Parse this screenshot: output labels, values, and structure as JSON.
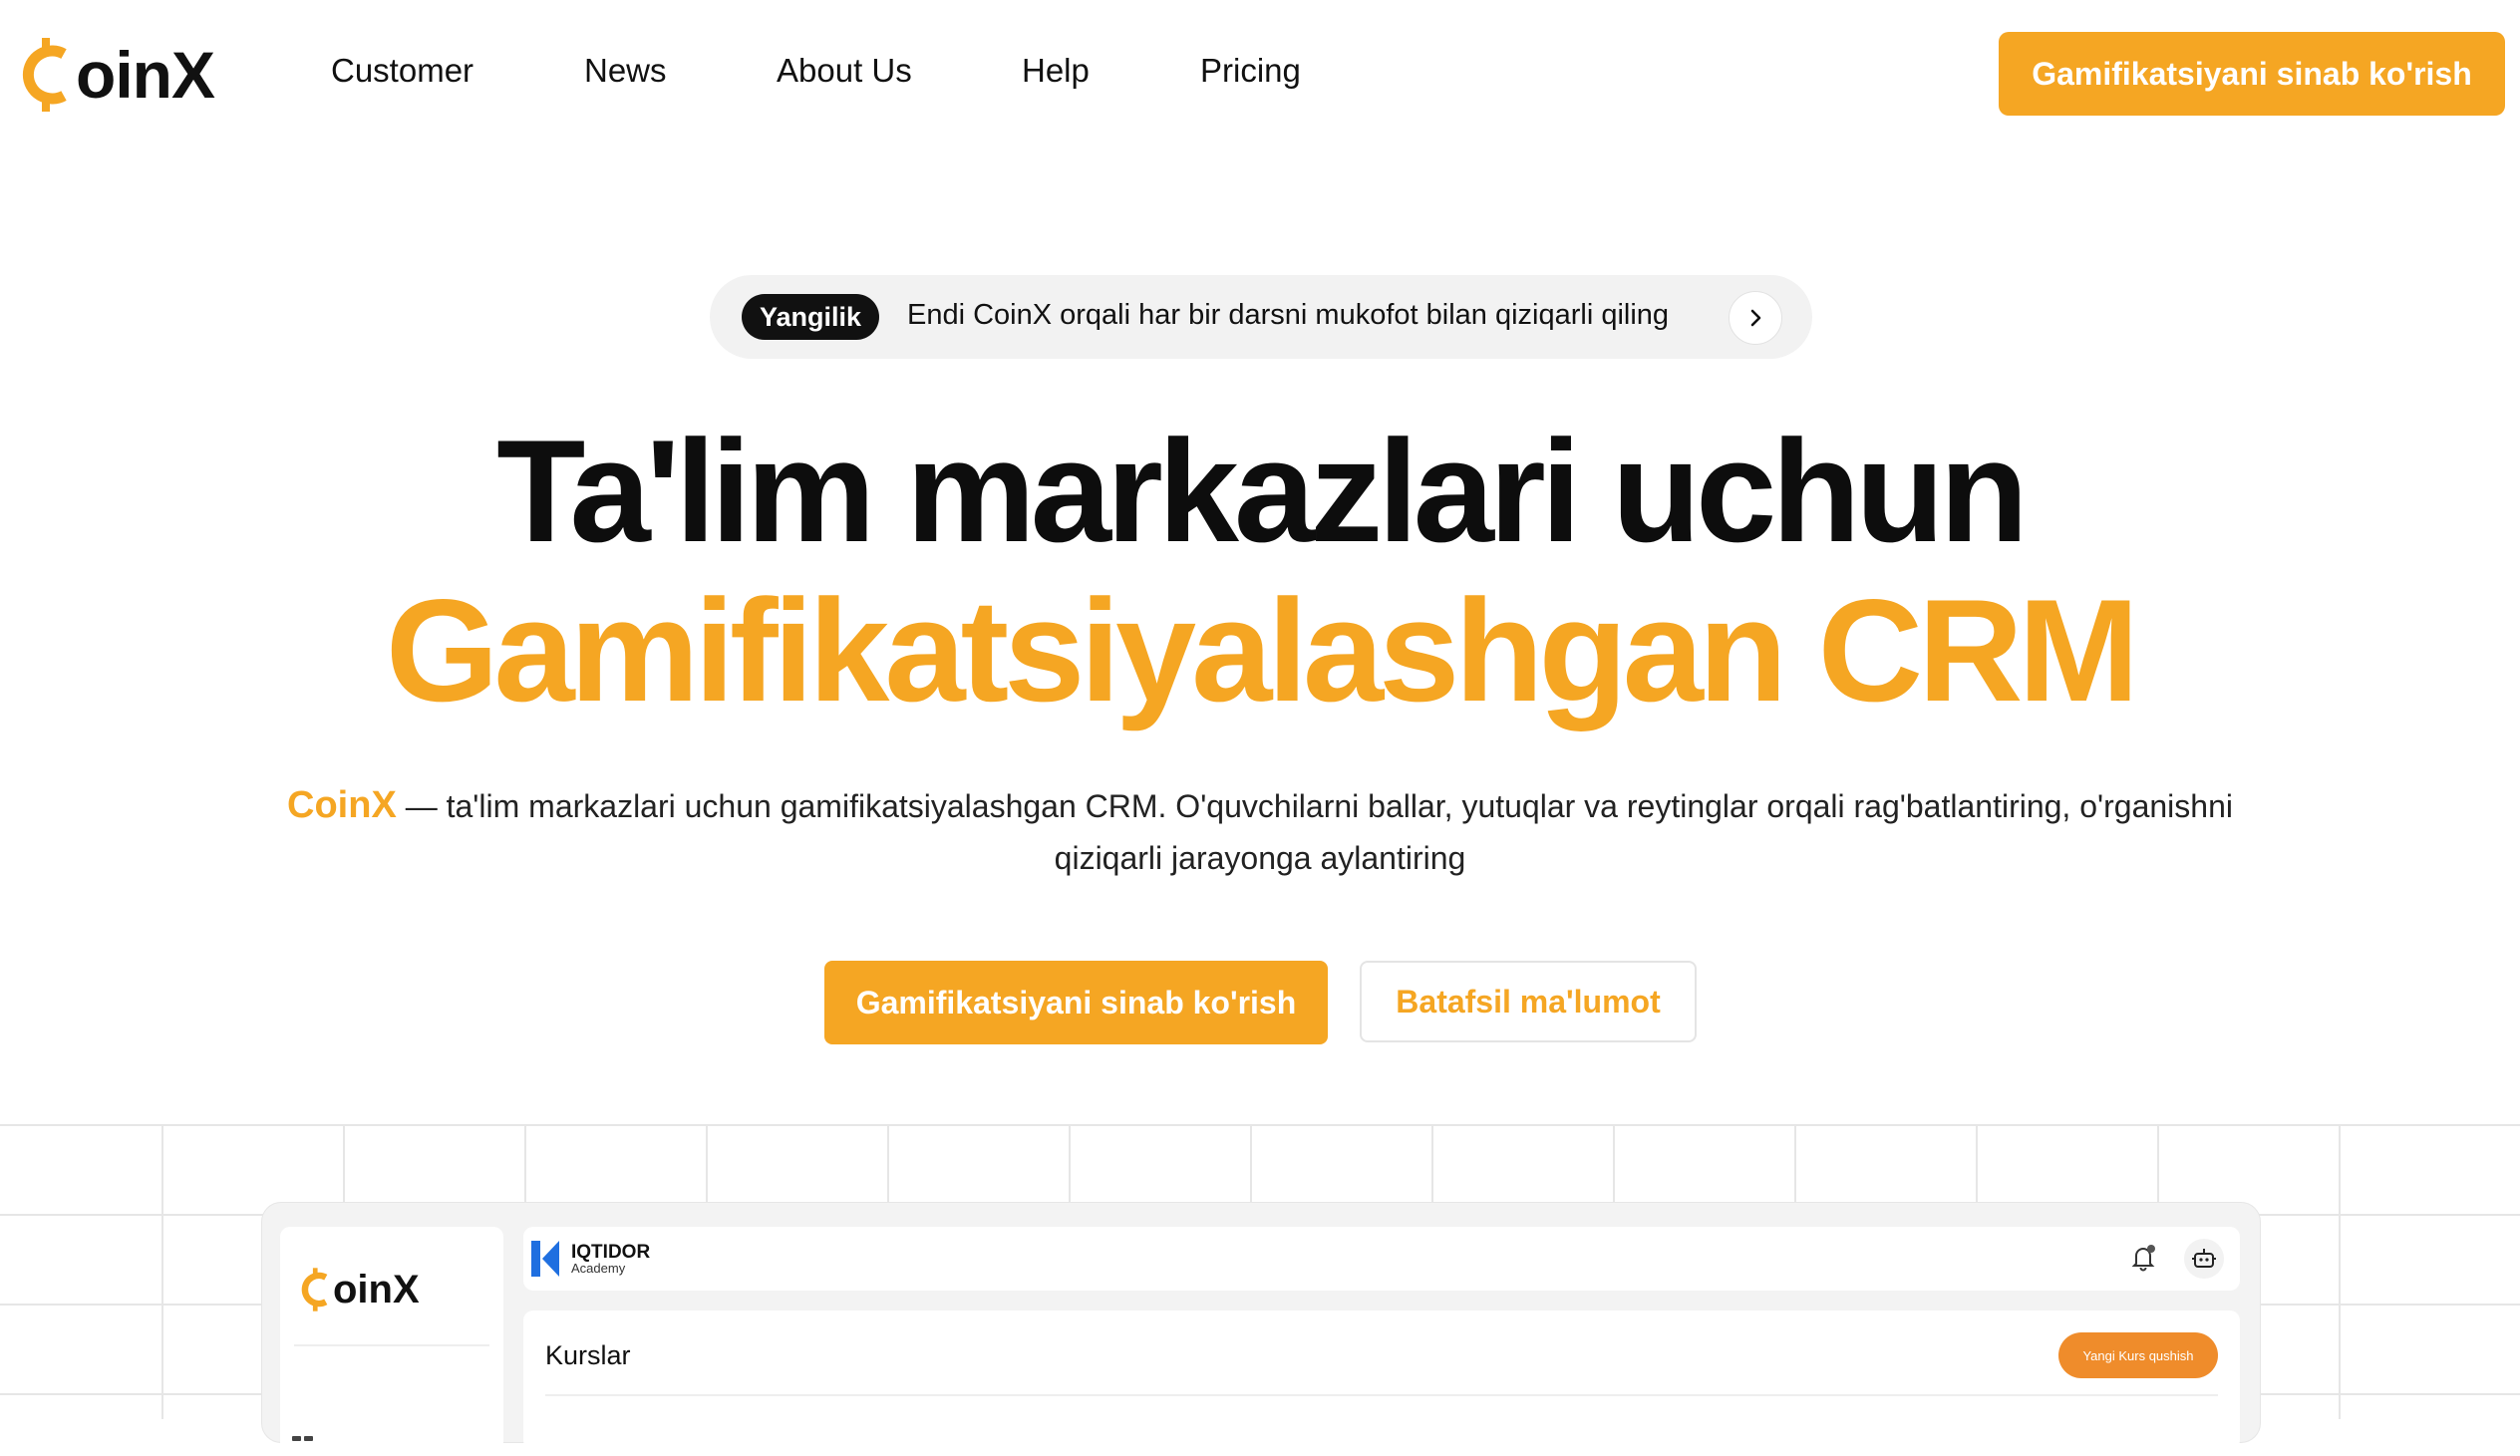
{
  "header": {
    "logo_text": "oinX",
    "nav": [
      {
        "label": "Customer"
      },
      {
        "label": "News"
      },
      {
        "label": "About Us"
      },
      {
        "label": "Help"
      },
      {
        "label": "Pricing"
      }
    ],
    "cta_label": "Gamifikatsiyani sinab ko'rish"
  },
  "announcement": {
    "badge": "Yangilik",
    "text": "Endi CoinX orqali har bir darsni mukofot bilan qiziqarli qiling",
    "arrow_icon": "chevron-right-icon"
  },
  "hero": {
    "title_line1": "Ta'lim markazlari uchun",
    "title_line2": "Gamifikatsiyalashgan CRM",
    "desc_brand": "CoinX",
    "desc_text": " — ta'lim markazlari uchun gamifikatsiyalashgan CRM. O'quvchilarni ballar, yutuqlar va reytinglar orqali rag'batlantiring, o'rganishni qiziqarli jarayonga aylantiring",
    "primary_cta": "Gamifikatsiyani sinab ko'rish",
    "secondary_cta": "Batafsil ma'lumot"
  },
  "preview": {
    "sidebar_logo_text": "oinX",
    "academy_name": "IQTIDOR",
    "academy_sub": "Academy",
    "page_title": "Kurslar",
    "add_button": "Yangi Kurs qushish"
  },
  "colors": {
    "accent": "#f5a623",
    "preview_accent": "#ef8c2b",
    "academy_blue": "#1f6fe0"
  }
}
